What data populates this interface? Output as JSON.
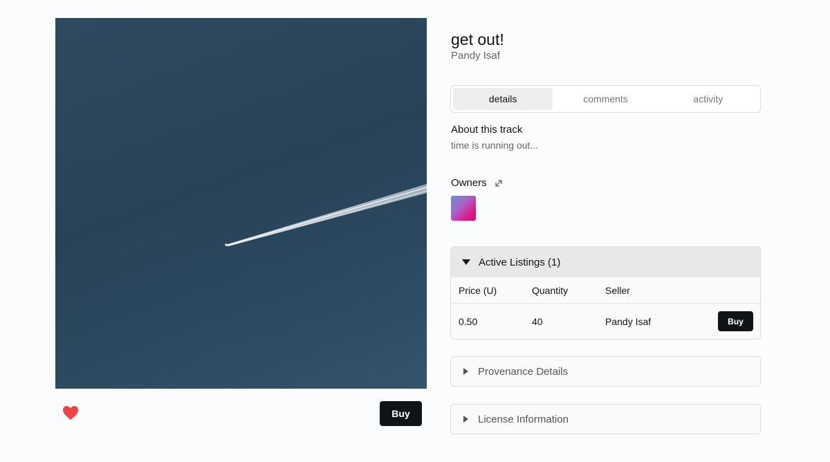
{
  "track": {
    "title": "get out!",
    "artist": "Pandy Isaf"
  },
  "tabs": [
    {
      "label": "details",
      "active": true
    },
    {
      "label": "comments",
      "active": false
    },
    {
      "label": "activity",
      "active": false
    }
  ],
  "about": {
    "heading": "About this track",
    "text": "time is running out..."
  },
  "owners": {
    "heading": "Owners",
    "expand_icon": "expand-arrow-icon"
  },
  "listings": {
    "heading": "Active Listings (1)",
    "columns": [
      "Price (U)",
      "Quantity",
      "Seller"
    ],
    "rows": [
      {
        "price": "0.50",
        "quantity": "40",
        "seller": "Pandy Isaf",
        "action": "Buy"
      }
    ]
  },
  "sections": {
    "provenance": "Provenance Details",
    "license": "License Information"
  },
  "actions": {
    "buy_label": "Buy",
    "like_icon": "heart-icon"
  },
  "colors": {
    "button_bg": "#111417",
    "heart": "#ef4444",
    "tab_active_bg": "#eceeef",
    "listings_header_bg": "#e7e8e9"
  }
}
